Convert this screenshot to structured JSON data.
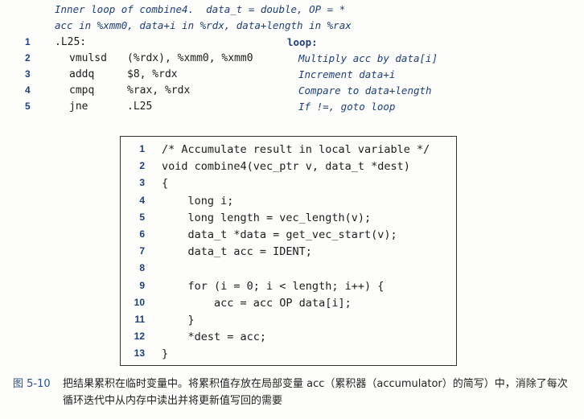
{
  "asm": {
    "comment_lines": [
      "Inner loop of combine4.  data_t = double, OP = *",
      "acc in %xmm0, data+i in %rdx, data+length in %rax"
    ],
    "lines": [
      {
        "num": "1",
        "label": ".L25:",
        "instr": "",
        "ops": "",
        "note": "loop:",
        "note_plain": true
      },
      {
        "num": "2",
        "label": "",
        "instr": "vmulsd",
        "ops": "(%rdx), %xmm0, %xmm0",
        "note": "Multiply acc by data[i]",
        "note_plain": false
      },
      {
        "num": "3",
        "label": "",
        "instr": "addq",
        "ops": "$8, %rdx",
        "note": "Increment data+i",
        "note_plain": false
      },
      {
        "num": "4",
        "label": "",
        "instr": "cmpq",
        "ops": "%rax, %rdx",
        "note": "Compare to data+length",
        "note_plain": false
      },
      {
        "num": "5",
        "label": "",
        "instr": "jne",
        "ops": ".L25",
        "note": "If !=, goto loop",
        "note_plain": false
      }
    ]
  },
  "code": {
    "lines": [
      {
        "num": "1",
        "text": "/* Accumulate result in local variable */"
      },
      {
        "num": "2",
        "text": "void combine4(vec_ptr v, data_t *dest)"
      },
      {
        "num": "3",
        "text": "{"
      },
      {
        "num": "4",
        "text": "    long i;"
      },
      {
        "num": "5",
        "text": "    long length = vec_length(v);"
      },
      {
        "num": "6",
        "text": "    data_t *data = get_vec_start(v);"
      },
      {
        "num": "7",
        "text": "    data_t acc = IDENT;"
      },
      {
        "num": "8",
        "text": ""
      },
      {
        "num": "9",
        "text": "    for (i = 0; i < length; i++) {"
      },
      {
        "num": "10",
        "text": "        acc = acc OP data[i];"
      },
      {
        "num": "11",
        "text": "    }"
      },
      {
        "num": "12",
        "text": "    *dest = acc;"
      },
      {
        "num": "13",
        "text": "}"
      }
    ]
  },
  "caption": {
    "label": "图 5-10",
    "text": "把结果累积在临时变量中。将累积值存放在局部变量 acc（累积器（accumulator）的简写）中，消除了每次循环迭代中从内存中读出并将更新值写回的需要"
  }
}
